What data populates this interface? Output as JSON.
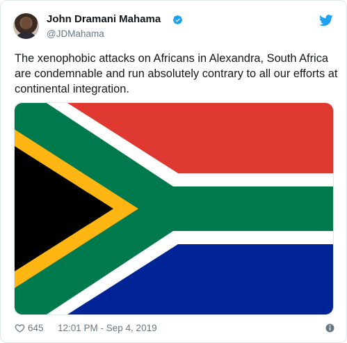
{
  "author": {
    "name": "John Dramani Mahama",
    "handle": "@JDMahama"
  },
  "tweet": {
    "text": "The xenophobic attacks on Africans in Alexandra, South Africa are condemnable and run absolutely contrary to all our efforts at continental integration."
  },
  "media": {
    "flag": "South Africa",
    "colors": {
      "red": "#de3831",
      "blue": "#002395",
      "green": "#007a4d",
      "gold": "#ffb612",
      "black": "#000000",
      "white": "#ffffff"
    }
  },
  "footer": {
    "likes": "645",
    "timestamp": "12:01 PM - Sep 4, 2019"
  },
  "icons": {
    "verified": "verified-badge-icon",
    "platform": "twitter-bird-icon",
    "like": "heart-icon",
    "info": "info-icon"
  },
  "theme": {
    "verified": "#1da1f2",
    "text": "#14171a",
    "muted": "#657786"
  }
}
